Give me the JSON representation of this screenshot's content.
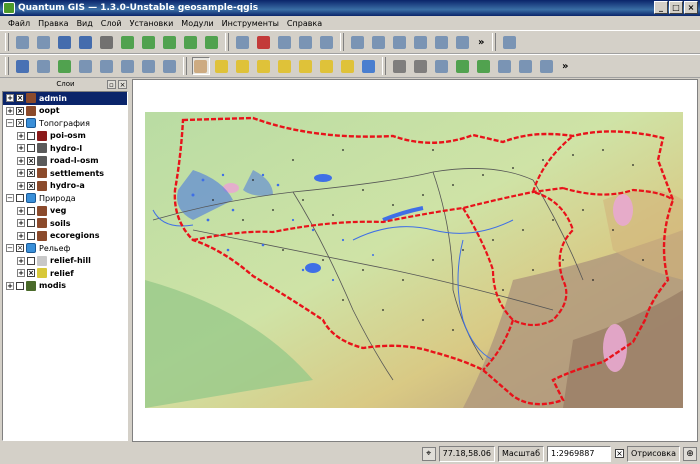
{
  "window": {
    "title": "Quantum GIS — 1.3.0-Unstable geosample-qgis",
    "controls": [
      "minimize",
      "maximize",
      "close"
    ]
  },
  "menu": [
    "Файл",
    "Правка",
    "Вид",
    "Слой",
    "Установки",
    "Модули",
    "Инструменты",
    "Справка"
  ],
  "toolbar_row1": {
    "file_icons": [
      "new-project-icon",
      "open-project-icon",
      "save-project-icon",
      "save-as-icon",
      "print-icon",
      "add-vector-icon",
      "add-raster-icon",
      "add-postgis-icon",
      "add-wms-icon",
      "add-layer-icon"
    ],
    "edit_icons": [
      "toggle-edit-icon",
      "remove-layer-icon",
      "capture-icon",
      "show-all-icon",
      "hide-all-icon"
    ],
    "plugin_icons": [
      "identify-select-icon",
      "select-icon",
      "attribute-table-icon",
      "measure-icon",
      "annotation-icon",
      "map-tips-icon"
    ],
    "extra_icons": [
      "python-console-icon"
    ],
    "overflow_label": "»"
  },
  "toolbar_row2": {
    "digitize_icons": [
      "pencil-icon",
      "move-feature-icon",
      "add-vertex-icon",
      "move-vertex-icon",
      "delete-vertex-icon",
      "cut-icon",
      "copy-icon",
      "paste-icon"
    ],
    "nav_icons": [
      "pan-icon",
      "zoom-in-icon",
      "zoom-out-icon",
      "zoom-full-icon",
      "zoom-selection-icon",
      "zoom-layer-icon",
      "zoom-last-icon",
      "zoom-next-icon",
      "refresh-icon"
    ],
    "adv_icons": [
      "undo-icon",
      "redo-icon",
      "simplify-icon",
      "add-ring-icon",
      "add-island-icon",
      "delete-ring-icon",
      "delete-part-icon",
      "reshape-icon"
    ],
    "overflow_label": "»"
  },
  "layers_panel": {
    "title": "Слои",
    "items": [
      {
        "label": "admin",
        "level": 0,
        "group": false,
        "checked": true,
        "selected": true,
        "icon_color": "#8b4a2b"
      },
      {
        "label": "oopt",
        "level": 0,
        "group": false,
        "checked": true,
        "selected": false,
        "icon_color": "#8b4a2b"
      },
      {
        "label": "Топография",
        "level": 0,
        "group": true,
        "checked": true,
        "selected": false,
        "icon_color": "#3a8fd8"
      },
      {
        "label": "poi-osm",
        "level": 1,
        "group": false,
        "checked": false,
        "selected": false,
        "icon_color": "#8b1a1a"
      },
      {
        "label": "hydro-l",
        "level": 1,
        "group": false,
        "checked": false,
        "selected": false,
        "icon_color": "#5a5a5a"
      },
      {
        "label": "road-l-osm",
        "level": 1,
        "group": false,
        "checked": true,
        "selected": false,
        "icon_color": "#5a5a5a"
      },
      {
        "label": "settlements",
        "level": 1,
        "group": false,
        "checked": true,
        "selected": false,
        "icon_color": "#8b4a2b"
      },
      {
        "label": "hydro-a",
        "level": 1,
        "group": false,
        "checked": true,
        "selected": false,
        "icon_color": "#8b4a2b"
      },
      {
        "label": "Природа",
        "level": 0,
        "group": true,
        "checked": false,
        "selected": false,
        "icon_color": "#3a8fd8"
      },
      {
        "label": "veg",
        "level": 1,
        "group": false,
        "checked": false,
        "selected": false,
        "icon_color": "#8b4a2b"
      },
      {
        "label": "soils",
        "level": 1,
        "group": false,
        "checked": false,
        "selected": false,
        "icon_color": "#8b4a2b"
      },
      {
        "label": "ecoregions",
        "level": 1,
        "group": false,
        "checked": false,
        "selected": false,
        "icon_color": "#8b4a2b"
      },
      {
        "label": "Рельеф",
        "level": 0,
        "group": true,
        "checked": true,
        "selected": false,
        "icon_color": "#3a8fd8"
      },
      {
        "label": "relief-hill",
        "level": 1,
        "group": false,
        "checked": false,
        "selected": false,
        "icon_color": "#c8c8c8"
      },
      {
        "label": "relief",
        "level": 1,
        "group": false,
        "checked": true,
        "selected": false,
        "icon_color": "#d8c838"
      },
      {
        "label": "modis",
        "level": 0,
        "group": false,
        "checked": false,
        "selected": false,
        "icon_color": "#4a6a2a"
      }
    ]
  },
  "statusbar": {
    "coordinates": "77.18,58.06",
    "scale_label": "Масштаб",
    "scale_value": "1:2969887",
    "render_label": "Отрисовка",
    "render_checked": true
  },
  "colors": {
    "boundary": "#e8121a",
    "lowland": "#c5e0a8",
    "upland": "#d9c27a",
    "mountain": "#a88a6c",
    "water": "#3f6fe6",
    "protected": "#e8a8d0"
  }
}
